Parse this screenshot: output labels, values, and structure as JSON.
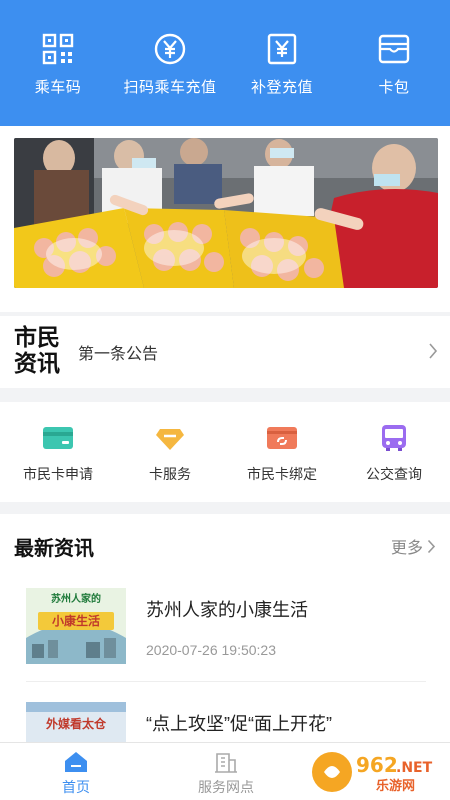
{
  "quick_actions": [
    {
      "label": "乘车码",
      "icon": "qr-code-icon"
    },
    {
      "label": "扫码乘车充值",
      "icon": "yuan-coin-icon"
    },
    {
      "label": "补登充值",
      "icon": "yuan-card-icon"
    },
    {
      "label": "卡包",
      "icon": "wallet-icon"
    }
  ],
  "notice": {
    "brand": "市民资讯",
    "text": "第一条公告"
  },
  "services": [
    {
      "label": "市民卡申请",
      "icon": "card-green-icon",
      "color": "#3cc6b0"
    },
    {
      "label": "卡服务",
      "icon": "card-gold-icon",
      "color": "#f5b740"
    },
    {
      "label": "市民卡绑定",
      "icon": "card-link-icon",
      "color": "#f07a5a"
    },
    {
      "label": "公交查询",
      "icon": "bus-icon",
      "color": "#9b6cf0"
    }
  ],
  "news": {
    "title": "最新资讯",
    "more": "更多",
    "items": [
      {
        "headline": "苏州人家的小康生活",
        "time": "2020-07-26 19:50:23",
        "thumb_text": "苏州人家的 小康生活"
      },
      {
        "headline": "“点上攻坚”促“面上开花”",
        "time": "",
        "thumb_text": "外媒看太仓"
      }
    ]
  },
  "tabs": [
    {
      "label": "首页",
      "icon": "home-icon",
      "active": true
    },
    {
      "label": "服务网点",
      "icon": "building-icon",
      "active": false
    }
  ],
  "watermark": {
    "text": "962.NET",
    "sub": "乐游网"
  },
  "colors": {
    "primary": "#3d8ff0",
    "background": "#f2f3f5"
  }
}
